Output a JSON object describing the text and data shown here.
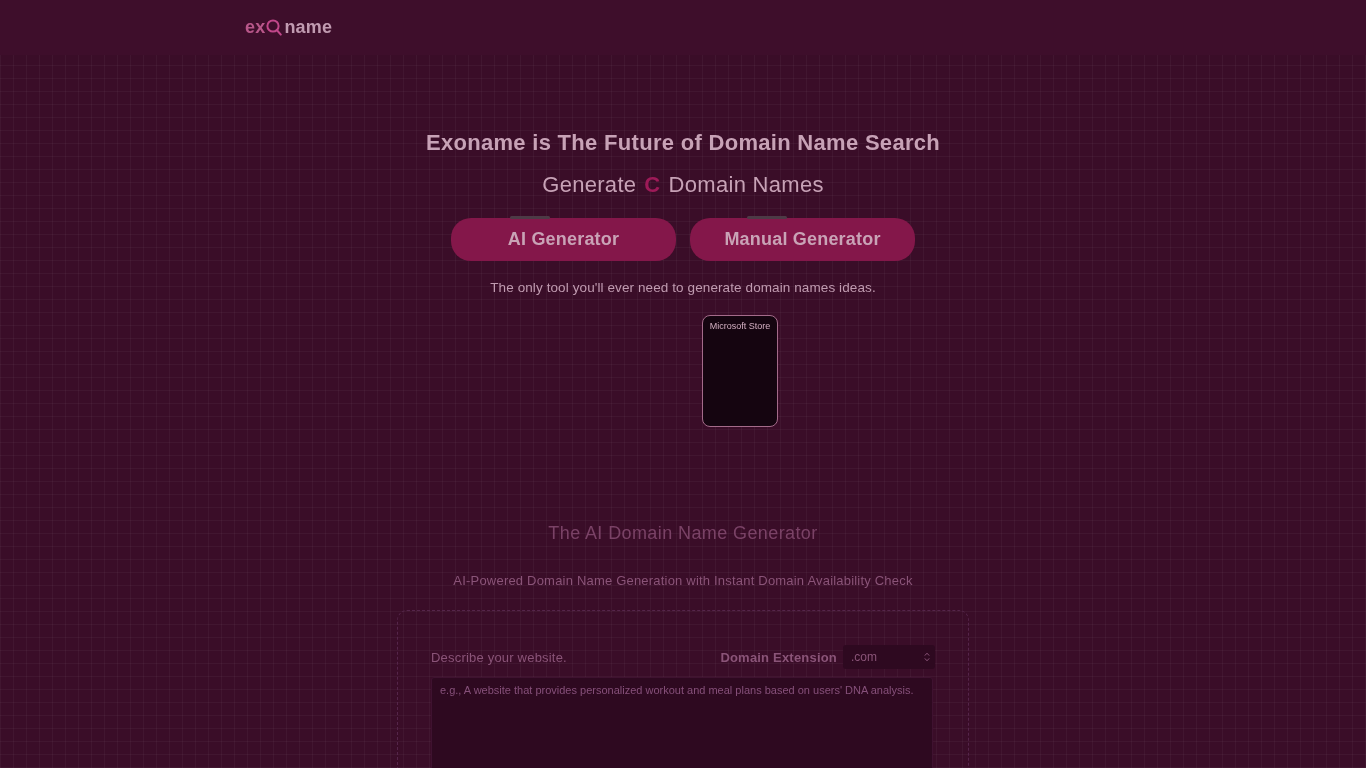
{
  "header": {
    "logo": {
      "prefix": "ex",
      "suffix": "name"
    }
  },
  "hero": {
    "title": "Exoname is The Future of Domain Name Search",
    "subtitle_before": "Generate",
    "rotating_word": "C",
    "subtitle_after": "Domain Names",
    "buttons": [
      {
        "label": "AI Generator"
      },
      {
        "label": "Manual Generator"
      }
    ],
    "tagline": "The only tool you'll ever need to generate domain names ideas.",
    "store_badge": {
      "label": "Microsoft Store"
    }
  },
  "generator": {
    "title": "The AI Domain Name Generator",
    "subtitle": "AI-Powered Domain Name Generation with Instant Domain Availability Check",
    "description_label": "Describe your website.",
    "extension_label": "Domain Extension",
    "extension_value": ".com",
    "description_placeholder": "e.g., A website that provides personalized workout and meal plans based on users' DNA analysis."
  }
}
